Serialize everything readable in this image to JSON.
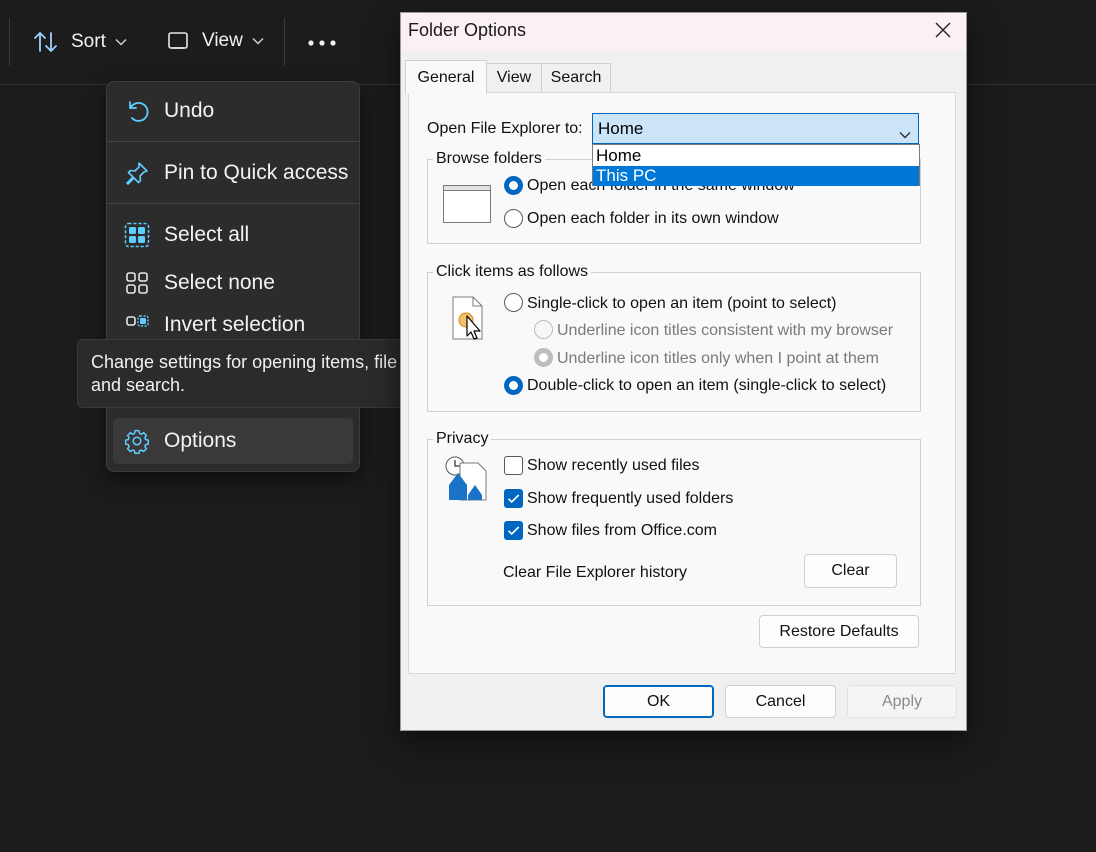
{
  "toolbar": {
    "sort_label": "Sort",
    "view_label": "View"
  },
  "menu": {
    "items": [
      {
        "label": "Undo",
        "icon": "undo-icon"
      },
      {
        "label": "Pin to Quick access",
        "icon": "pin-icon"
      },
      {
        "label": "Select all",
        "icon": "select-all-icon"
      },
      {
        "label": "Select none",
        "icon": "select-none-icon"
      },
      {
        "label": "Invert selection",
        "icon": "invert-selection-icon"
      },
      {
        "label": "Options",
        "icon": "gear-icon"
      }
    ]
  },
  "tooltip": {
    "line1": "Change settings for opening items, file",
    "line2": "and search."
  },
  "dialog": {
    "title": "Folder Options",
    "tabs": [
      "General",
      "View",
      "Search"
    ],
    "open_to_label": "Open File Explorer to:",
    "open_to_value": "Home",
    "open_to_options": [
      "Home",
      "This PC"
    ],
    "browse_title": "Browse folders",
    "browse_options": [
      "Open each folder in the same window",
      "Open each folder in its own window"
    ],
    "click_title": "Click items as follows",
    "click_options": [
      "Single-click to open an item (point to select)",
      "Underline icon titles consistent with my browser",
      "Underline icon titles only when I point at them",
      "Double-click to open an item (single-click to select)"
    ],
    "privacy_title": "Privacy",
    "privacy_options": [
      "Show recently used files",
      "Show frequently used folders",
      "Show files from Office.com"
    ],
    "clear_history_label": "Clear File Explorer history",
    "clear_button": "Clear",
    "restore_button": "Restore Defaults",
    "ok_button": "OK",
    "cancel_button": "Cancel",
    "apply_button": "Apply"
  },
  "colors": {
    "accent": "#0067c0",
    "highlight": "#0078d7",
    "combo_bg": "#cce4f7",
    "menu_icon": "#60cdff"
  }
}
